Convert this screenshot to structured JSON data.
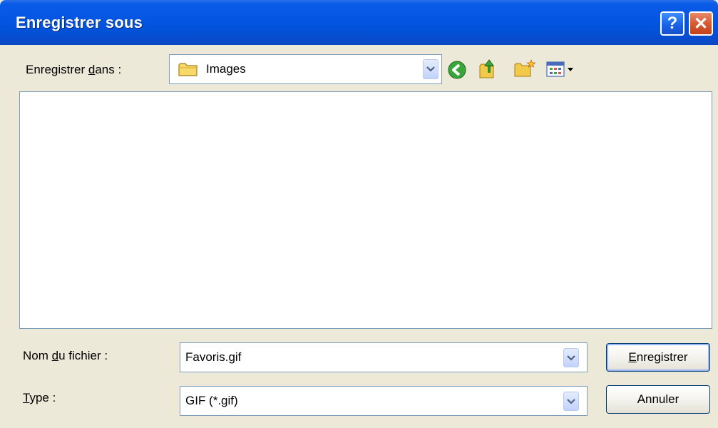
{
  "window": {
    "title": "Enregistrer sous",
    "help_glyph": "?",
    "close_glyph": "✕"
  },
  "save_in": {
    "label_prefix": "Enregistrer ",
    "label_accel": "d",
    "label_suffix": "ans :",
    "value": "Images",
    "icon": "folder-icon"
  },
  "toolbar": {
    "icons": [
      "back-icon",
      "up-folder-icon",
      "new-folder-icon",
      "view-menu-icon"
    ]
  },
  "filename": {
    "label_prefix": "Nom ",
    "label_accel": "d",
    "label_suffix": "u fichier :",
    "value": "Favoris.gif"
  },
  "filetype": {
    "label_accel": "T",
    "label_suffix": "ype :",
    "value": "GIF (*.gif)"
  },
  "buttons": {
    "save_accel": "E",
    "save_rest": "nregistrer",
    "cancel": "Annuler"
  },
  "colors": {
    "titlebar": "#0355e2",
    "dialog_bg": "#ece9d8",
    "border": "#7f9db9"
  }
}
